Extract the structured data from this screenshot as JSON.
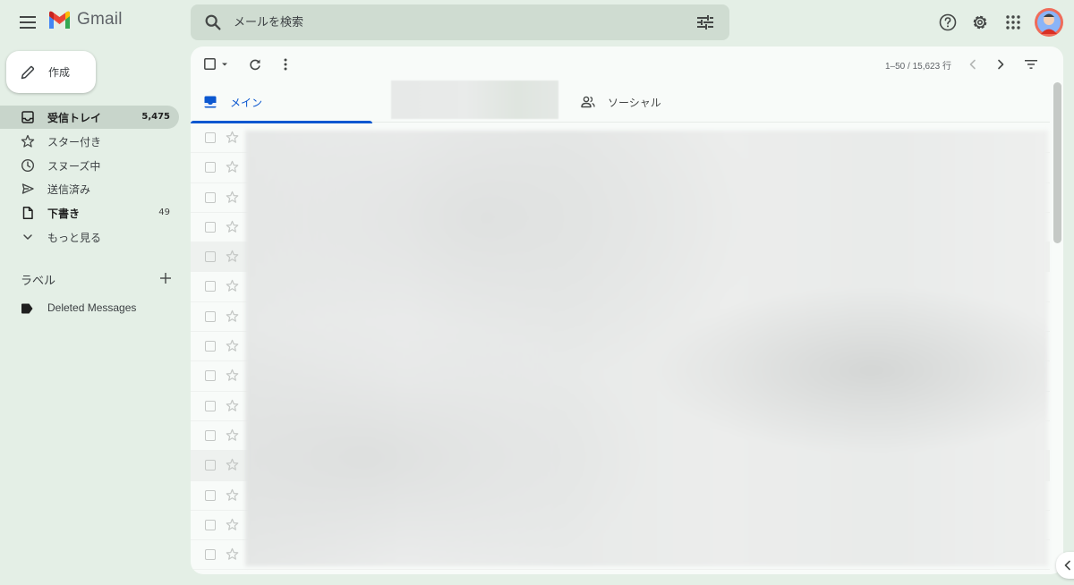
{
  "app": {
    "brand": "Gmail"
  },
  "search": {
    "placeholder": "メールを検索"
  },
  "compose": {
    "label": "作成"
  },
  "nav": {
    "inbox": {
      "label": "受信トレイ",
      "count": "5,475"
    },
    "starred": {
      "label": "スター付き"
    },
    "snoozed": {
      "label": "スヌーズ中"
    },
    "sent": {
      "label": "送信済み"
    },
    "drafts": {
      "label": "下書き",
      "count": "49"
    },
    "more": {
      "label": "もっと見る"
    }
  },
  "labels": {
    "heading": "ラベル",
    "items": [
      {
        "label": "Deleted Messages"
      }
    ]
  },
  "toolbar": {
    "pager": "1–50 / 15,623 行"
  },
  "tabs": {
    "main": {
      "label": "メイン"
    },
    "social": {
      "label": "ソーシャル"
    }
  },
  "email_rows": {
    "count_visible": 15,
    "selected_rows": [
      5,
      12
    ]
  },
  "colors": {
    "accent": "#0b57d0",
    "background": "#e4efe6",
    "panel": "#f8fbf9",
    "gmail_red": "#ea4335"
  }
}
